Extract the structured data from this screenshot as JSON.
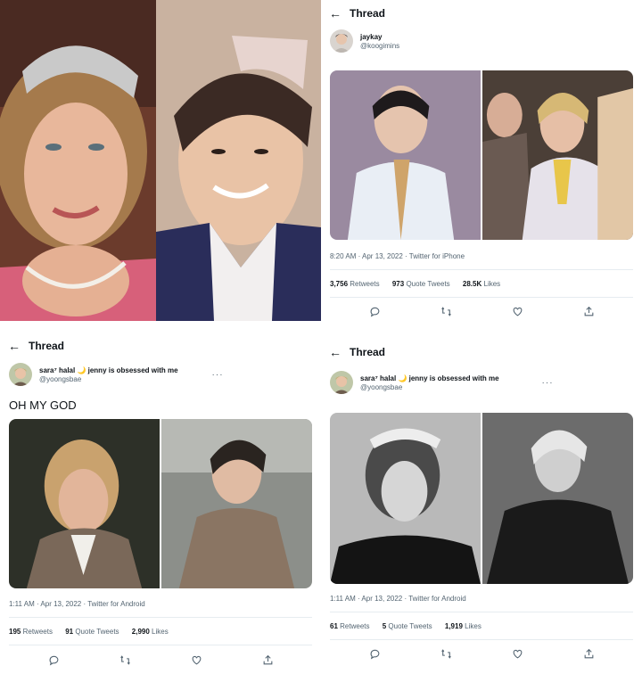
{
  "collage_left_top": {
    "description_labels": []
  },
  "thread_top_right": {
    "header_title": "Thread",
    "display_name": "jaykay",
    "handle": "@koogimins",
    "timestamp": "8:20 AM · Apr 13, 2022 · Twitter for iPhone",
    "retweets": "3,756",
    "retweets_label": "Retweets",
    "quotes": "973",
    "quotes_label": "Quote Tweets",
    "likes": "28.5K",
    "likes_label": "Likes"
  },
  "thread_bottom_left": {
    "header_title": "Thread",
    "display_name": "sara⁷ halal 🌙 jenny is obsessed with me",
    "handle": "@yoongsbae",
    "tweet_text": "OH MY GOD",
    "timestamp": "1:11 AM · Apr 13, 2022 · Twitter for Android",
    "retweets": "195",
    "retweets_label": "Retweets",
    "quotes": "91",
    "quotes_label": "Quote Tweets",
    "likes": "2,990",
    "likes_label": "Likes"
  },
  "thread_bottom_right": {
    "header_title": "Thread",
    "display_name": "sara⁷ halal 🌙 jenny is obsessed with me",
    "handle": "@yoongsbae",
    "timestamp": "1:11 AM · Apr 13, 2022 · Twitter for Android",
    "retweets": "61",
    "retweets_label": "Retweets",
    "quotes": "5",
    "quotes_label": "Quote Tweets",
    "likes": "1,919",
    "likes_label": "Likes"
  },
  "icons": {
    "back": "back-arrow-icon",
    "more": "more-icon",
    "reply": "reply-icon",
    "retweet": "retweet-icon",
    "like": "like-icon",
    "share": "share-icon"
  },
  "colors": {
    "text": "#0f1419",
    "muted": "#536471",
    "divider": "#e6ecf0"
  }
}
